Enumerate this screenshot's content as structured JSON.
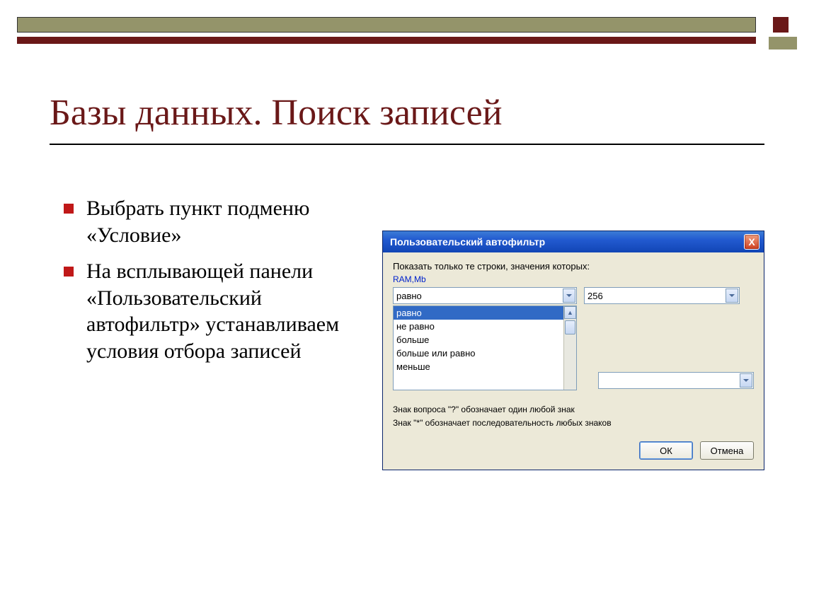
{
  "slide": {
    "title": "Базы данных. Поиск записей",
    "bullets": [
      "Выбрать пункт подменю «Условие»",
      "На всплывающей панели «Пользовательский автофильтр» устанавливаем условия отбора записей"
    ]
  },
  "dialog": {
    "title": "Пользовательский автофильтр",
    "close_label": "X",
    "instruction": "Показать только те строки, значения которых:",
    "field_label": "RAM,Mb",
    "condition_selected": "равно",
    "value_input": "256",
    "options": [
      "равно",
      "не равно",
      "больше",
      "больше или равно",
      "меньше"
    ],
    "second_value": "",
    "hint1": "Знак вопроса \"?\" обозначает один любой знак",
    "hint2": "Знак \"*\" обозначает последовательность любых знаков",
    "ok_label": "ОК",
    "cancel_label": "Отмена"
  }
}
